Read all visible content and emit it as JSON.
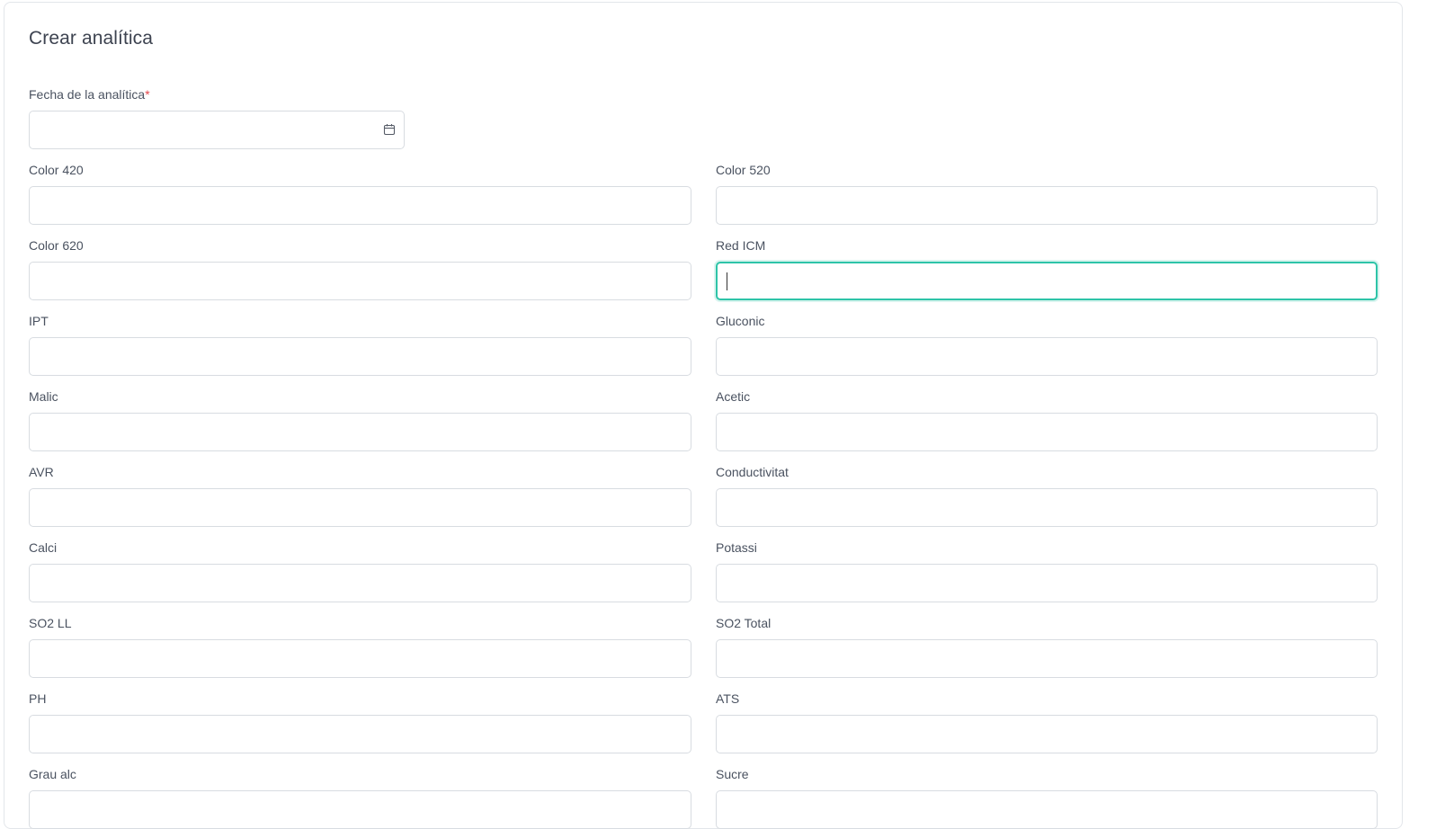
{
  "form": {
    "title": "Crear analítica",
    "date_field": {
      "label": "Fecha de la analítica",
      "required_mark": "*",
      "value": "",
      "icon": "calendar-icon"
    },
    "fields": [
      {
        "key": "color_420",
        "label": "Color 420",
        "value": ""
      },
      {
        "key": "color_520",
        "label": "Color 520",
        "value": ""
      },
      {
        "key": "color_620",
        "label": "Color 620",
        "value": ""
      },
      {
        "key": "red_icm",
        "label": "Red ICM",
        "value": "",
        "focused": true
      },
      {
        "key": "ipt",
        "label": "IPT",
        "value": ""
      },
      {
        "key": "gluconic",
        "label": "Gluconic",
        "value": ""
      },
      {
        "key": "malic",
        "label": "Malic",
        "value": ""
      },
      {
        "key": "acetic",
        "label": "Acetic",
        "value": ""
      },
      {
        "key": "avr",
        "label": "AVR",
        "value": ""
      },
      {
        "key": "conductivitat",
        "label": "Conductivitat",
        "value": ""
      },
      {
        "key": "calci",
        "label": "Calci",
        "value": ""
      },
      {
        "key": "potassi",
        "label": "Potassi",
        "value": ""
      },
      {
        "key": "so2_ll",
        "label": "SO2 LL",
        "value": ""
      },
      {
        "key": "so2_total",
        "label": "SO2 Total",
        "value": ""
      },
      {
        "key": "ph",
        "label": "PH",
        "value": ""
      },
      {
        "key": "ats",
        "label": "ATS",
        "value": ""
      },
      {
        "key": "grau_alc",
        "label": "Grau alc",
        "value": ""
      },
      {
        "key": "sucre",
        "label": "Sucre",
        "value": ""
      }
    ]
  },
  "colors": {
    "focus_border": "#2ec4a8",
    "required": "#e5484d",
    "input_border": "#d8dce1",
    "text": "#4a5260"
  }
}
